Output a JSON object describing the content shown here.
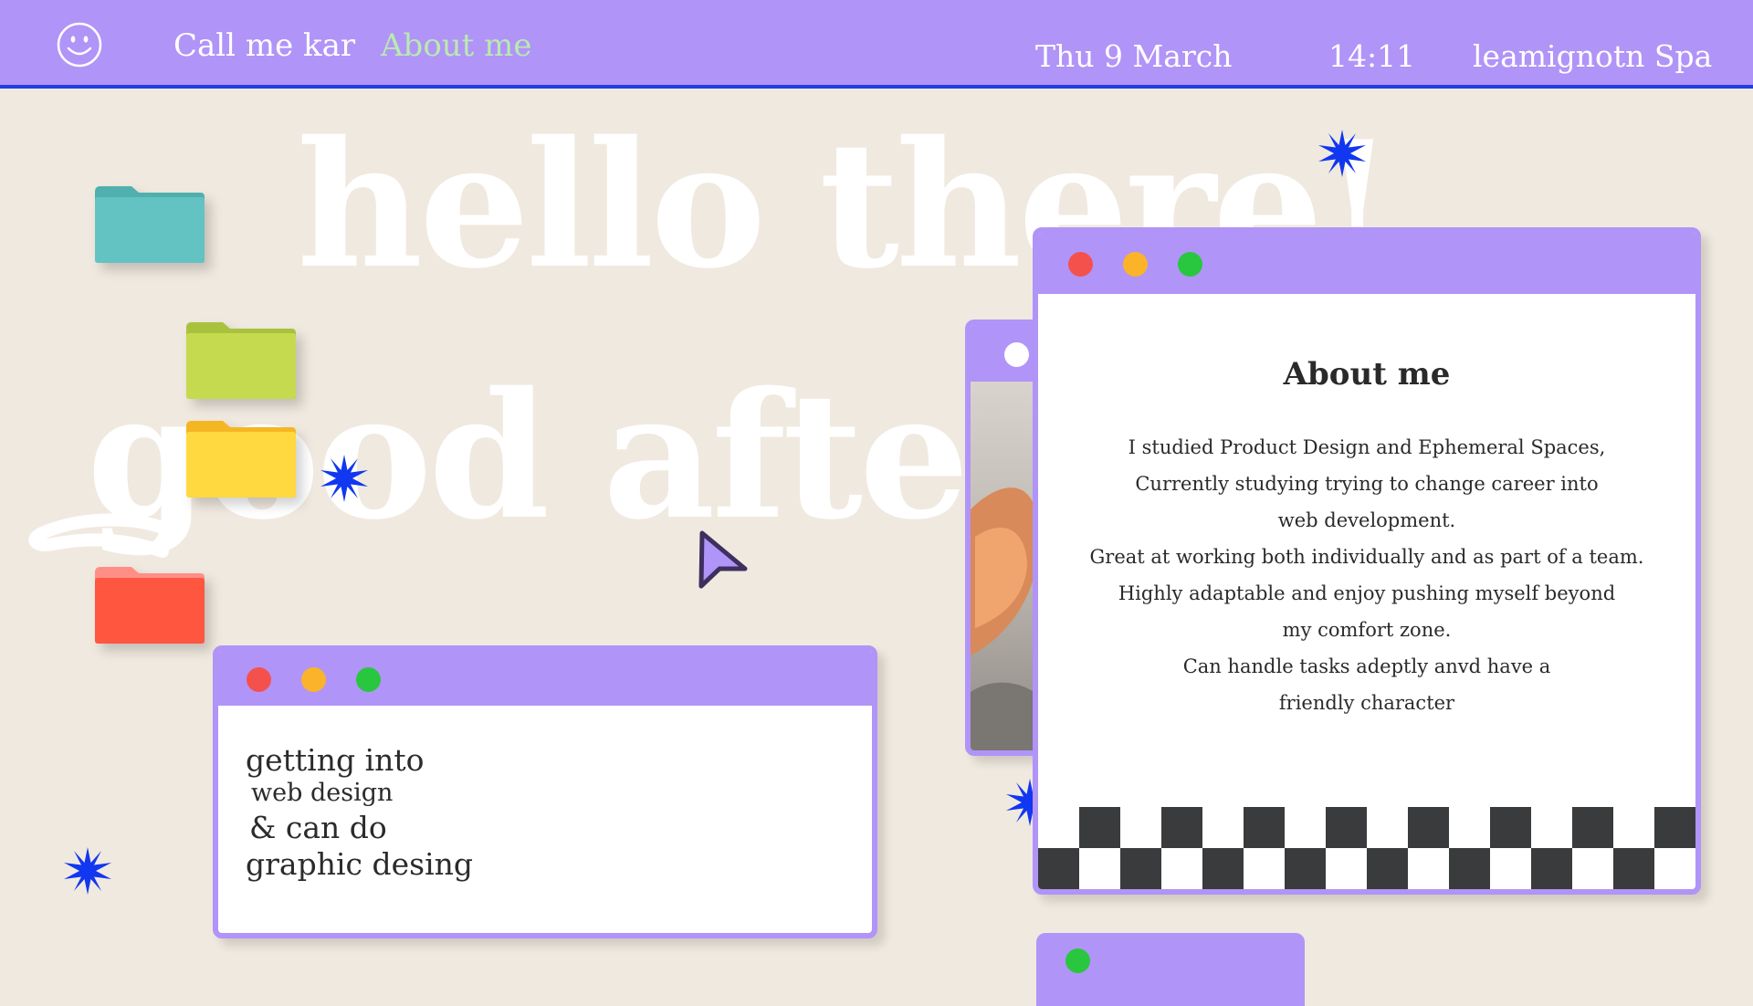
{
  "topbar": {
    "nav": [
      {
        "label": "Call me kar"
      },
      {
        "label": "About me"
      }
    ],
    "status": {
      "date": "Thu 9 March",
      "time": "14:11",
      "location": "leamignotn Spa"
    }
  },
  "greeting": {
    "line1": "hello there!",
    "line2": "good aftern"
  },
  "folders": [
    {
      "color": "#63c3c2",
      "name": "teal-folder"
    },
    {
      "color": "#c6da4f",
      "name": "lime-folder"
    },
    {
      "color": "#ffd93f",
      "name": "yellow-folder"
    },
    {
      "color": "#ff5640",
      "name": "red-folder"
    }
  ],
  "skills_window": {
    "lines": [
      "getting into",
      "web design",
      "& can do",
      "graphic desing"
    ]
  },
  "about_window": {
    "title": "About me",
    "lines": [
      "I studied Product Design and Ephemeral Spaces,",
      "Currently studying trying to change career into",
      "web development.",
      "Great at working both individually and as part of a team.",
      "Highly adaptable and enjoy pushing myself beyond",
      "my comfort zone.",
      "Can handle tasks adeptly anvd have a",
      "friendly character"
    ]
  },
  "colors": {
    "background": "#f0e9df",
    "accent_purple": "#b194f7",
    "accent_blue": "#1f3fe0",
    "nav_active": "#b9eab0",
    "text_dark": "#2a2a2a"
  }
}
